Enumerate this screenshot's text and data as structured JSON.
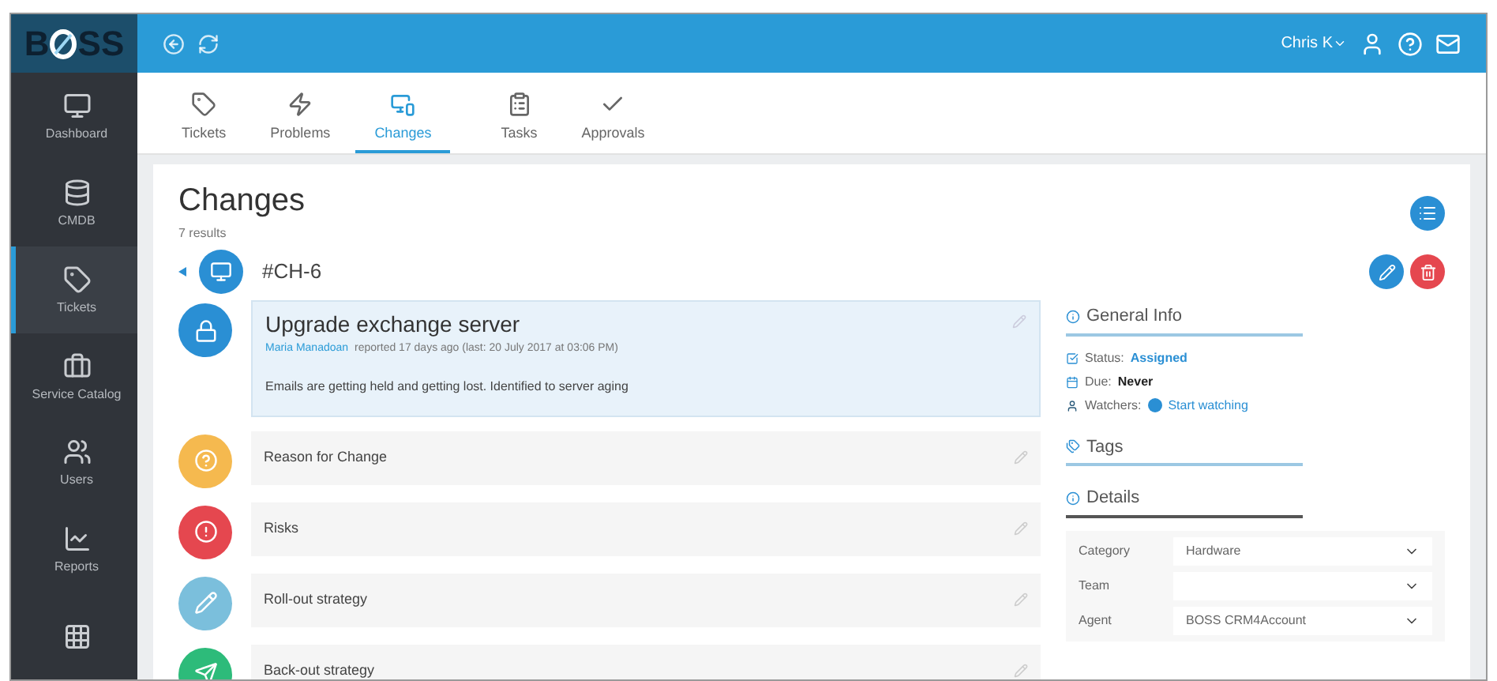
{
  "logo": {
    "before": "B",
    "after": "SS"
  },
  "user": {
    "name": "Chris K"
  },
  "sidebar": {
    "items": [
      {
        "label": "Dashboard",
        "selected": false
      },
      {
        "label": "CMDB",
        "selected": false
      },
      {
        "label": "Tickets",
        "selected": true
      },
      {
        "label": "Service Catalog",
        "selected": false
      },
      {
        "label": "Users",
        "selected": false
      },
      {
        "label": "Reports",
        "selected": false
      },
      {
        "selected": false
      }
    ]
  },
  "tabs": [
    {
      "label": "Tickets",
      "selected": false
    },
    {
      "label": "Problems",
      "selected": false
    },
    {
      "label": "Changes",
      "selected": true
    },
    {
      "label": "Tasks",
      "selected": false
    },
    {
      "label": "Approvals",
      "selected": false
    }
  ],
  "page": {
    "title": "Changes",
    "count": "7 results"
  },
  "change": {
    "id": "#CH-6",
    "sections": [
      {
        "kind": "main",
        "color": "#2a8fd4",
        "title": "Upgrade exchange server",
        "author": "Maria Manadoan",
        "meta": "reported 17 days ago (last: 20 July 2017 at 03:06 PM)",
        "body": "Emails are getting held and getting lost. Identified to server aging"
      },
      {
        "kind": "plain",
        "color": "#f5b94f",
        "title": "Reason for Change"
      },
      {
        "kind": "plain",
        "color": "#e5474f",
        "title": "Risks"
      },
      {
        "kind": "plain",
        "color": "#7bbfdc",
        "title": "Roll-out strategy"
      },
      {
        "kind": "plain",
        "color": "#2dbb7a",
        "title": "Back-out strategy"
      }
    ]
  },
  "general_info": {
    "title": "General Info",
    "status_label": "Status:",
    "status": "Assigned",
    "due_label": "Due:",
    "due": "Never",
    "watchers_label": "Watchers:",
    "watch_link": "Start watching"
  },
  "tags": {
    "title": "Tags"
  },
  "details": {
    "title": "Details",
    "fields": [
      {
        "label": "Category",
        "value": "Hardware"
      },
      {
        "label": "Team"
      },
      {
        "label": "Agent",
        "value": "BOSS CRM4Account"
      }
    ]
  }
}
